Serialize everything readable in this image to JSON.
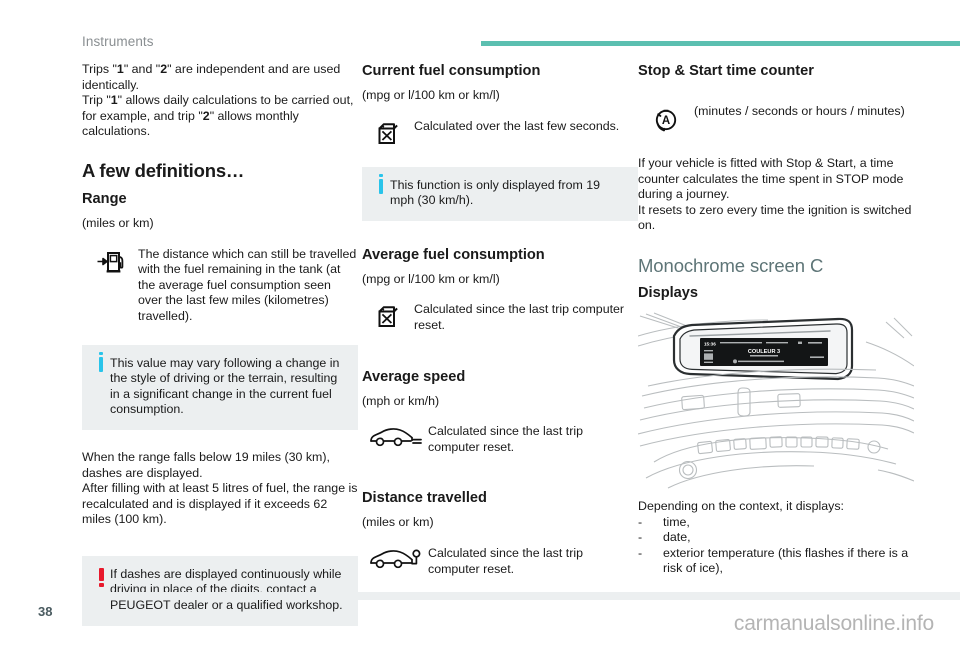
{
  "header": {
    "chapter": "Instruments",
    "rule_color": "#5bbfb0"
  },
  "column_left": {
    "intro_p1": "Trips \"1\" and \"2\" are independent and are used identically.",
    "intro_p2": "Trip \"1\" allows daily calculations to be carried out, for example, and trip \"2\" allows monthly calculations.",
    "section_title": "A few definitions…",
    "range": {
      "title": "Range",
      "unit": "(miles or km)",
      "icon": "fuel-pump-arrow-icon",
      "description": "The distance which can still be travelled with the fuel remaining in the tank (at the average fuel consumption seen over the last few miles (kilometres) travelled)."
    },
    "note_info": {
      "mark": "info-mark",
      "text": "This value may vary following a change in the style of driving or the terrain, resulting in a significant change in the current fuel consumption."
    },
    "body_p1": "When the range falls below 19 miles (30 km), dashes are displayed.",
    "body_p2": "After filling with at least 5 litres of fuel, the range is recalculated and is displayed if it exceeds 62 miles (100 km).",
    "note_warning": {
      "mark": "warning-mark",
      "text": "If dashes are displayed continuously while driving in place of the digits, contact a PEUGEOT dealer or a qualified workshop."
    }
  },
  "column_middle": {
    "current_fuel": {
      "title": "Current fuel consumption",
      "unit": "(mpg or l/100 km or km/l)",
      "icon": "jerrycan-cross-icon",
      "description": "Calculated over the last few seconds."
    },
    "note_info": {
      "mark": "info-mark",
      "text": "This function is only displayed from 19 mph (30 km/h)."
    },
    "average_fuel": {
      "title": "Average fuel consumption",
      "unit": "(mpg or l/100 km or km/l)",
      "icon": "jerrycan-cross-icon",
      "description": "Calculated since the last trip computer reset."
    },
    "average_speed": {
      "title": "Average speed",
      "unit": "(mph or km/h)",
      "icon": "car-average-speed-icon",
      "description": "Calculated since the last trip computer reset."
    },
    "distance": {
      "title": "Distance travelled",
      "unit": "(miles or km)",
      "icon": "car-distance-icon",
      "description": "Calculated since the last trip computer reset."
    }
  },
  "column_right": {
    "stop_start": {
      "title": "Stop & Start time counter",
      "icon": "stop-start-a-icon",
      "unit": "(minutes / seconds or hours / minutes)",
      "body_p1": "If your vehicle is fitted with Stop & Start, a time counter calculates the time spent in STOP mode during a journey.",
      "body_p2": "It resets to zero every time the ignition is switched on."
    },
    "monochrome": {
      "title": "Monochrome screen C",
      "title_color": "#5e7577",
      "subtitle": "Displays",
      "illustration": "dashboard-monochrome-screen-illustration",
      "screen_text": "COULEUR 3",
      "screen_time": "15:36",
      "intro": "Depending on the context, it displays:",
      "items": [
        "time,",
        "date,",
        "exterior temperature (this flashes if there is a risk of ice),"
      ],
      "dash": "-"
    }
  },
  "footer": {
    "page_number": "38",
    "watermark": "carmanualsonline.info"
  }
}
